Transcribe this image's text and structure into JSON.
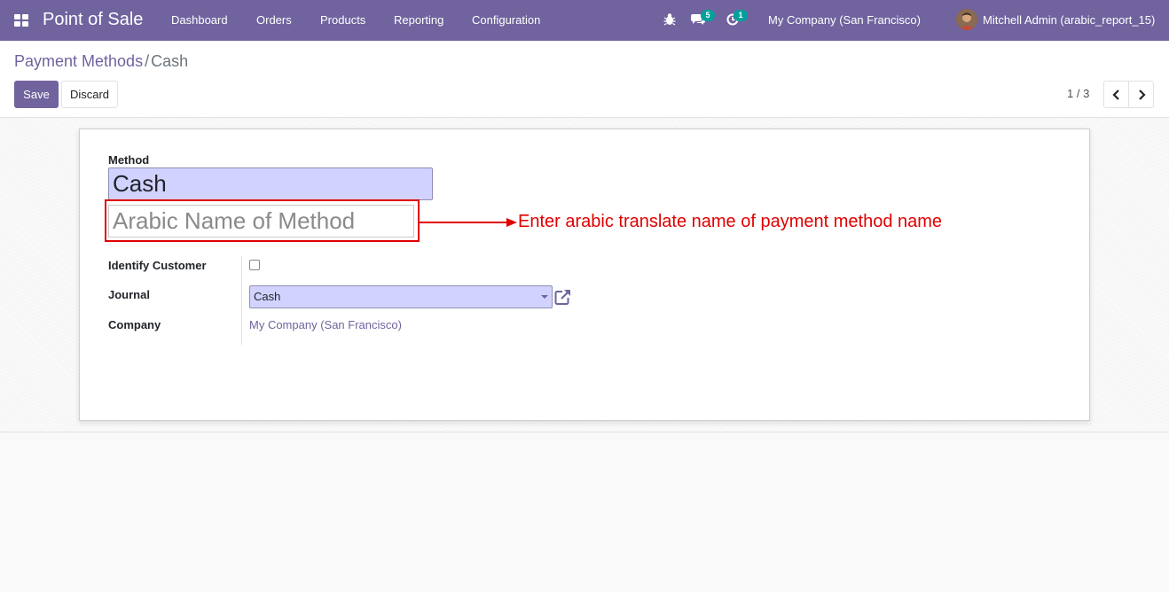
{
  "navbar": {
    "app_name": "Point of Sale",
    "menu": [
      "Dashboard",
      "Orders",
      "Products",
      "Reporting",
      "Configuration"
    ],
    "messages_count": "5",
    "activities_count": "1",
    "company": "My Company (San Francisco)",
    "user": "Mitchell Admin (arabic_report_15)",
    "accent_color": "#71639e"
  },
  "breadcrumb": {
    "parent": "Payment Methods",
    "separator": "/",
    "current": "Cash"
  },
  "actions": {
    "save_label": "Save",
    "discard_label": "Discard"
  },
  "pager": {
    "value": "1 / 3"
  },
  "form": {
    "method_label": "Method",
    "method_value": "Cash",
    "arabic_placeholder": "Arabic Name of Method",
    "annotation": "Enter arabic translate name of payment method name",
    "identify_customer_label": "Identify Customer",
    "identify_customer_checked": false,
    "journal_label": "Journal",
    "journal_value": "Cash",
    "company_label": "Company",
    "company_value": "My Company (San Francisco)"
  }
}
